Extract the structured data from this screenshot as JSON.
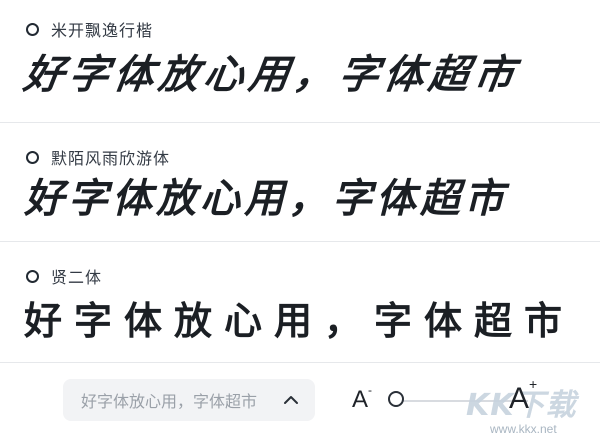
{
  "fonts": [
    {
      "name": "米开飘逸行楷",
      "sample": "好字体放心用，字体超市"
    },
    {
      "name": "默陌风雨欣游体",
      "sample": "好字体放心用，字体超市"
    },
    {
      "name": "贤二体",
      "sample": "好字体放心用，字体超市"
    }
  ],
  "preview": {
    "text": "好字体放心用，字体超市"
  },
  "size_control": {
    "decrease_label": "A",
    "decrease_mark": "-",
    "increase_label": "A",
    "increase_mark": "+",
    "level": 0.0
  },
  "watermark": {
    "logo": "KK下载",
    "url": "www.kkx.net"
  },
  "colors": {
    "ring": "#222a33",
    "divider": "#e6e8eb",
    "preview_bg": "#f2f3f5"
  }
}
